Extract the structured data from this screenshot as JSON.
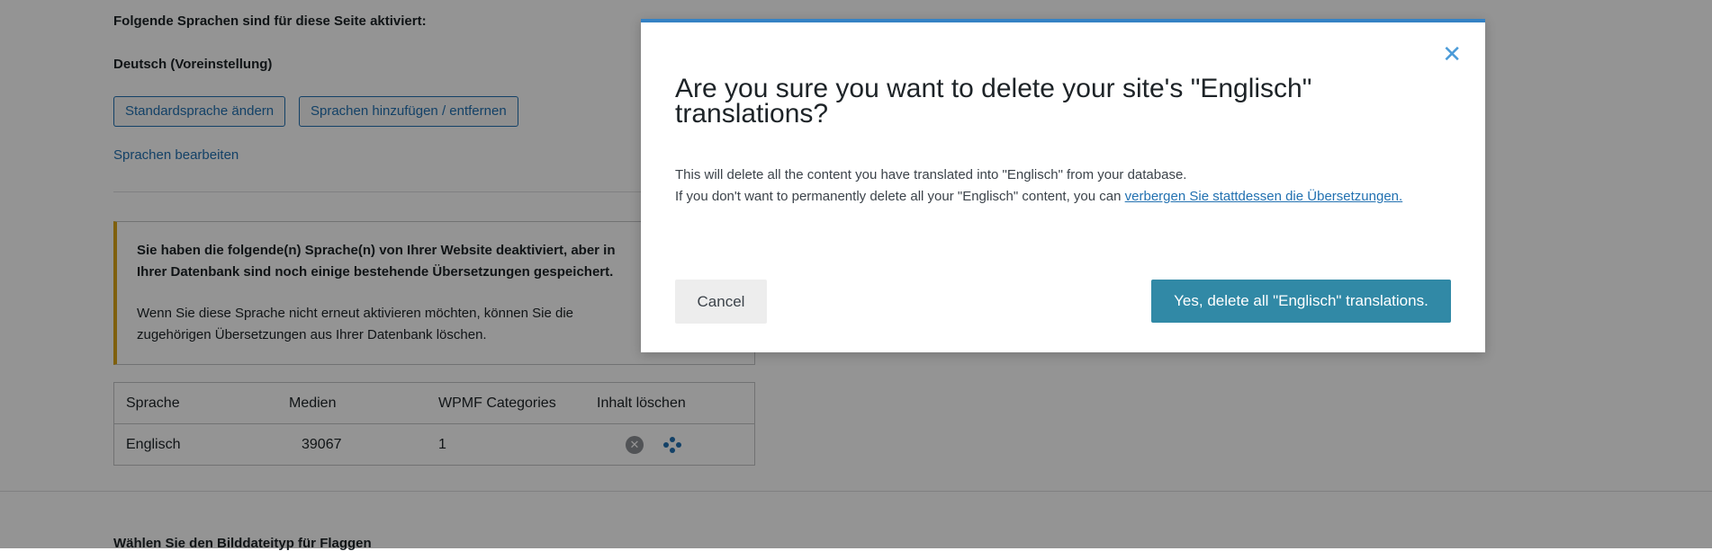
{
  "background": {
    "intro_text": "Folgende Sprachen sind für diese Seite aktiviert:",
    "default_language": "Deutsch (Voreinstellung)",
    "buttons": {
      "change_default": "Standardsprache ändern",
      "add_remove": "Sprachen hinzufügen / entfernen"
    },
    "edit_languages_link": "Sprachen bearbeiten",
    "notice": {
      "bold_text": "Sie haben die folgende(n) Sprache(n) von Ihrer Website deaktiviert, aber in Ihrer Datenbank sind noch einige bestehende Übersetzungen gespeichert.",
      "text": "Wenn Sie diese Sprache nicht erneut aktivieren möchten, können Sie die zugehörigen Übersetzungen aus Ihrer Datenbank löschen."
    },
    "table": {
      "headers": [
        "Sprache",
        "Medien",
        "WPMF Categories",
        "Inhalt löschen"
      ],
      "rows": [
        {
          "language": "Englisch",
          "media": "39067",
          "wpmf_categories": "1"
        }
      ]
    },
    "bottom_label": "Wählen Sie den Bilddateityp für Flaggen"
  },
  "modal": {
    "close_icon": "close-icon",
    "title": "Are you sure you want to delete your site's \"Englisch\" translations?",
    "body_line1": "This will delete all the content you have translated into \"Englisch\" from your database.",
    "body_line2_prefix": "If you don't want to permanently delete all your \"Englisch\" content, you can ",
    "body_link": "verbergen Sie stattdessen die Übersetzungen.",
    "cancel_label": "Cancel",
    "confirm_label": "Yes, delete all \"Englisch\" translations."
  },
  "colors": {
    "accent": "#3189a6",
    "link": "#2271b1",
    "notice_border": "#dba617",
    "modal_top_border": "#3582c4"
  }
}
